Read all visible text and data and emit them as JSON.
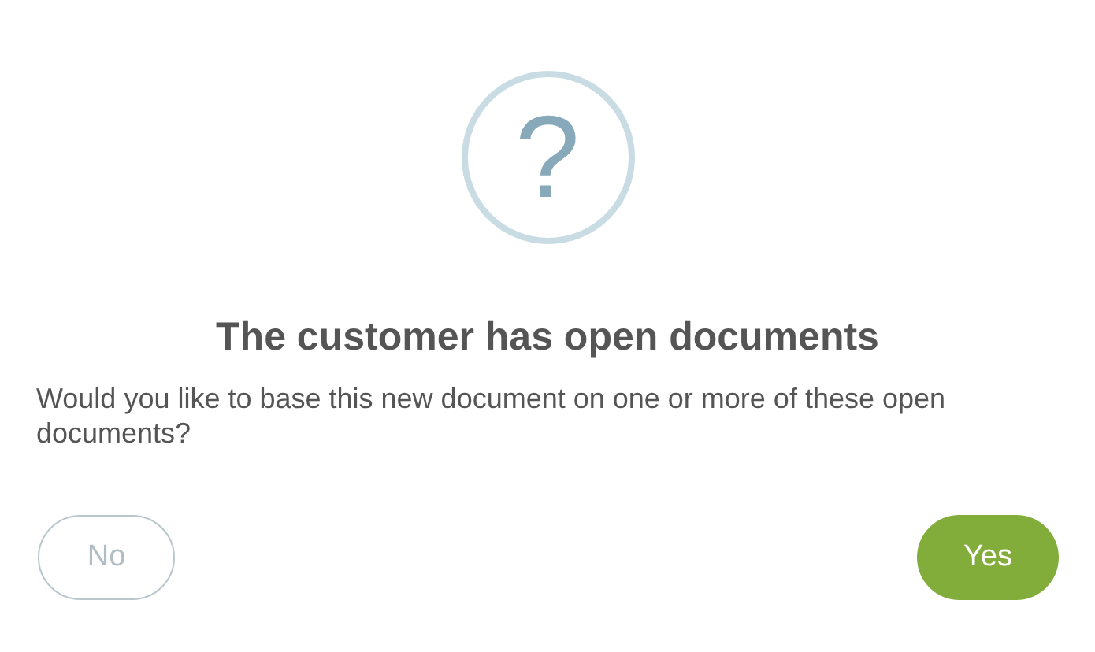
{
  "icon_glyph": "?",
  "title": "The customer has open documents",
  "message": "Would you like to base this new document on one or more of these open documents?",
  "buttons": [
    {
      "label": "No",
      "kind": "secondary"
    },
    {
      "label": "Yes",
      "kind": "primary"
    }
  ]
}
